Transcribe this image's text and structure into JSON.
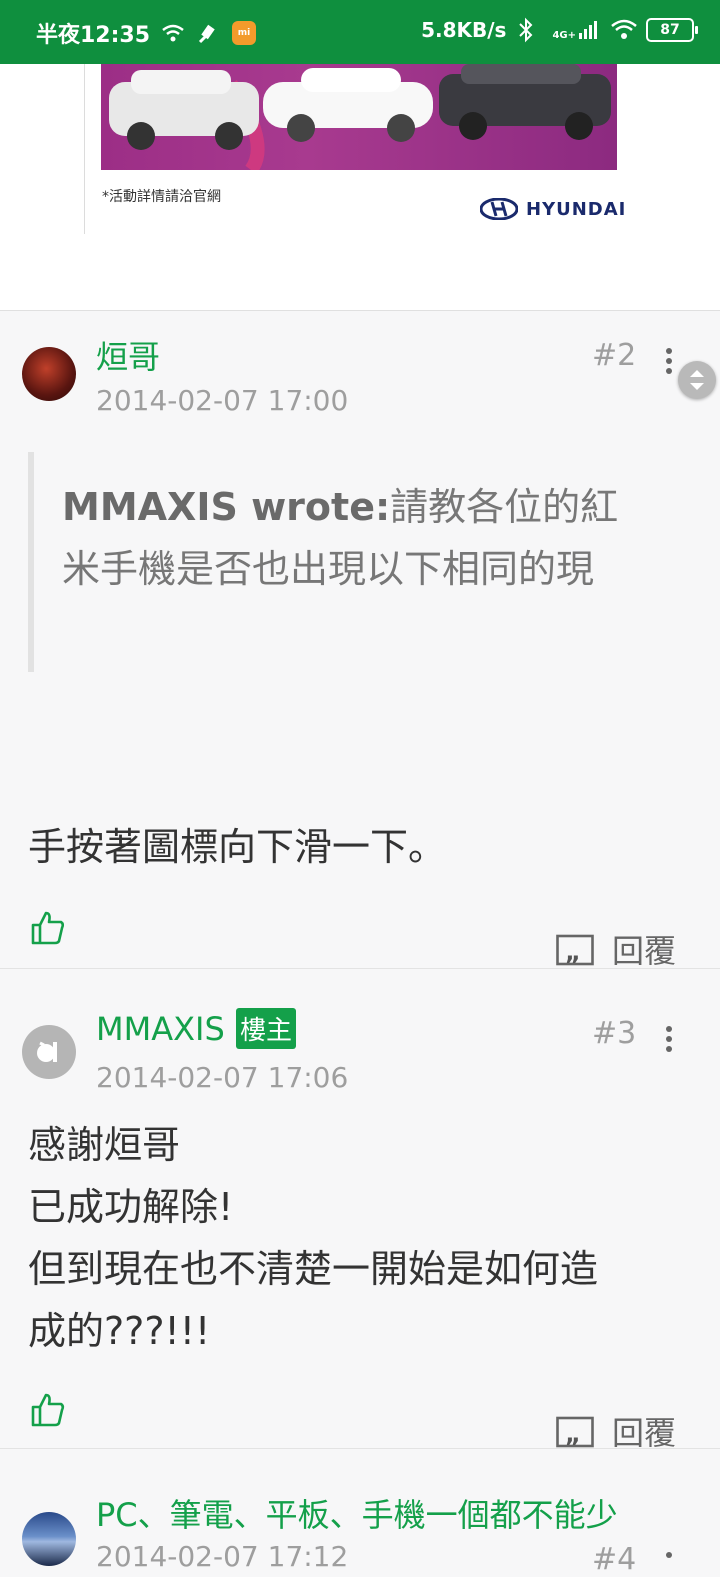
{
  "status_bar": {
    "time": "半夜12:35",
    "net_speed": "5.8KB/s",
    "net_type": "4G+",
    "battery": "87"
  },
  "ad": {
    "note": "*活動詳情請洽官網",
    "brand": "HYUNDAI"
  },
  "posts": [
    {
      "author": "烜哥",
      "floor": "#2",
      "date": "2014-02-07 17:00",
      "quote_author": "MMAXIS wrote:",
      "quote_text": "請教各位的紅米手機是否也出現以下相同的現",
      "body": "手按著圖標向下滑一下。",
      "reply_label": "回覆"
    },
    {
      "author": "MMAXIS",
      "owner_badge": "樓主",
      "floor": "#3",
      "date": "2014-02-07 17:06",
      "body_lines": [
        "感謝烜哥",
        "已成功解除!",
        "但到現在也不清楚一開始是如何造",
        "成的???!!!"
      ],
      "reply_label": "回覆"
    },
    {
      "author": "PC、筆電、平板、手機一個都不能少",
      "floor": "#4",
      "date": "2014-02-07 17:12"
    }
  ],
  "colors": {
    "status_bar": "#0f8f3e",
    "accent_green": "#14a04a"
  }
}
